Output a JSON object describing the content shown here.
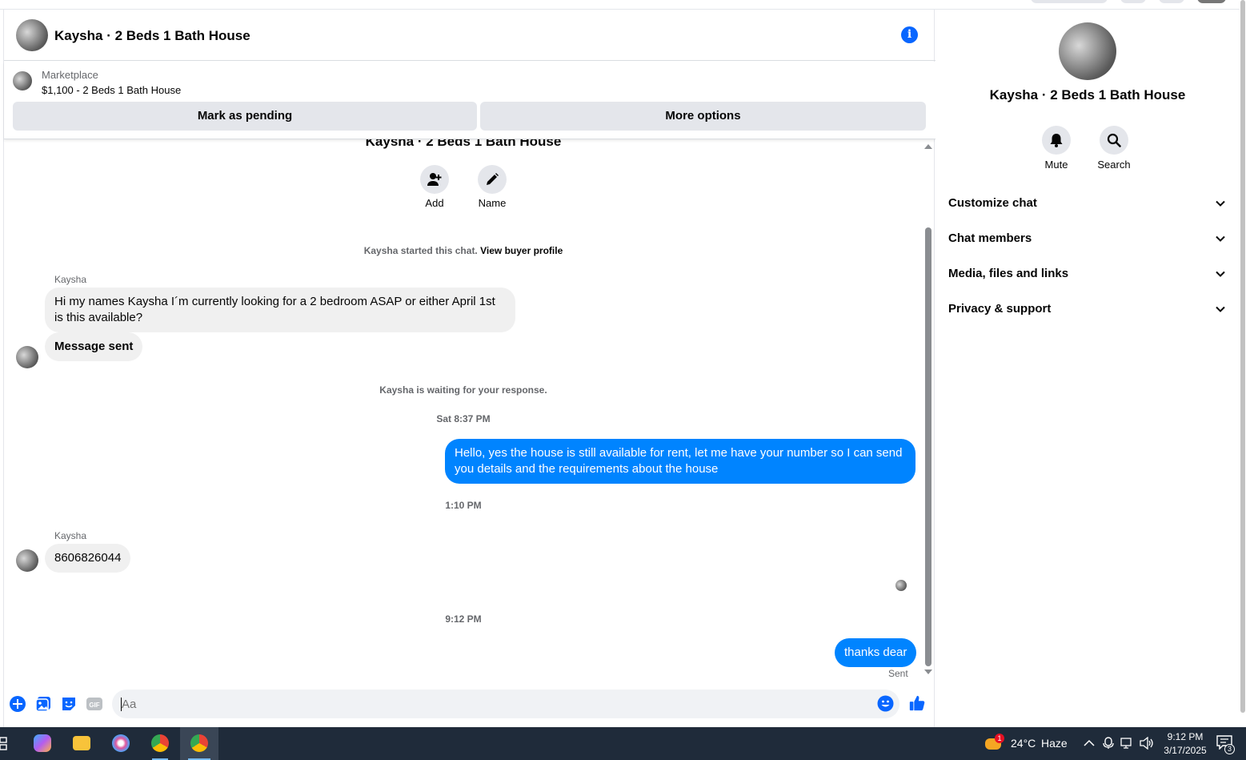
{
  "header": {
    "title": "Kaysha · 2 Beds 1 Bath House"
  },
  "marketplace": {
    "label": "Marketplace",
    "listing": "$1,100 - 2 Beds 1 Bath House",
    "pending_button": "Mark as pending",
    "more_button": "More options"
  },
  "thread": {
    "title": "Kaysha · 2 Beds 1 Bath House",
    "add_label": "Add",
    "name_label": "Name",
    "started_text": "Kaysha started this chat.",
    "buyer_profile_link": "View buyer profile",
    "sender1": "Kaysha",
    "msg1": "Hi my names Kaysha I´m currently looking for a 2 bedroom ASAP or either April 1st is this available?",
    "msg2": "Message sent",
    "waiting_text": "Kaysha is waiting for your response.",
    "time1": "Sat 8:37 PM",
    "msg3": "Hello, yes the house is still available for rent, let me have your number so I can send you details and the requirements about the house",
    "time2": "1:10 PM",
    "sender2": "Kaysha",
    "msg4": "8606826044",
    "time3": "9:12 PM",
    "msg5": "thanks dear",
    "sent_status": "Sent"
  },
  "composer": {
    "placeholder": "Aa",
    "gif_label": "GIF"
  },
  "panel": {
    "name": "Kaysha · 2 Beds 1 Bath House",
    "mute_label": "Mute",
    "search_label": "Search",
    "sections": [
      "Customize chat",
      "Chat members",
      "Media, files and links",
      "Privacy & support"
    ]
  },
  "taskbar": {
    "weather_temp": "24°C",
    "weather_desc": "Haze",
    "weather_badge": "1",
    "time": "9:12 PM",
    "date": "3/17/2025",
    "notification_count": "3"
  },
  "colors": {
    "accent": "#0084ff",
    "brand": "#0866ff",
    "bubble_in": "#f0f0f0",
    "taskbar": "#1f2b3a"
  }
}
